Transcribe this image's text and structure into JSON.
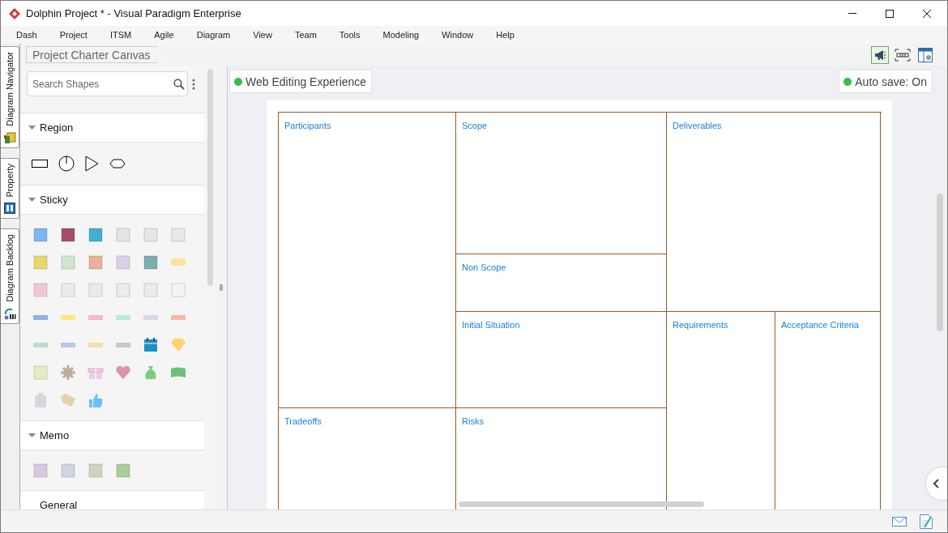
{
  "window": {
    "title": "Dolphin Project * - Visual Paradigm Enterprise"
  },
  "menu": [
    "Dash",
    "Project",
    "ITSM",
    "Agile",
    "Diagram",
    "View",
    "Team",
    "Tools",
    "Modeling",
    "Window",
    "Help"
  ],
  "side_tabs": [
    {
      "label": "Diagram Navigator"
    },
    {
      "label": "Property"
    },
    {
      "label": "Diagram Backlog"
    }
  ],
  "breadcrumb": "Project Charter Canvas",
  "palette": {
    "search": {
      "placeholder": "Search Shapes"
    },
    "sections": [
      {
        "title": "Region"
      },
      {
        "title": "Sticky"
      },
      {
        "title": "Memo"
      },
      {
        "title": "General"
      }
    ]
  },
  "canvas": {
    "web_editing": "Web Editing Experience",
    "auto_save": "Auto save: On",
    "cells": [
      {
        "label": "Participants"
      },
      {
        "label": "Scope"
      },
      {
        "label": "Deliverables"
      },
      {
        "label": "Non Scope"
      },
      {
        "label": "Initial Situation"
      },
      {
        "label": "Requirements"
      },
      {
        "label": "Acceptance Criteria"
      },
      {
        "label": "Tradeoffs"
      },
      {
        "label": "Risks"
      }
    ]
  }
}
